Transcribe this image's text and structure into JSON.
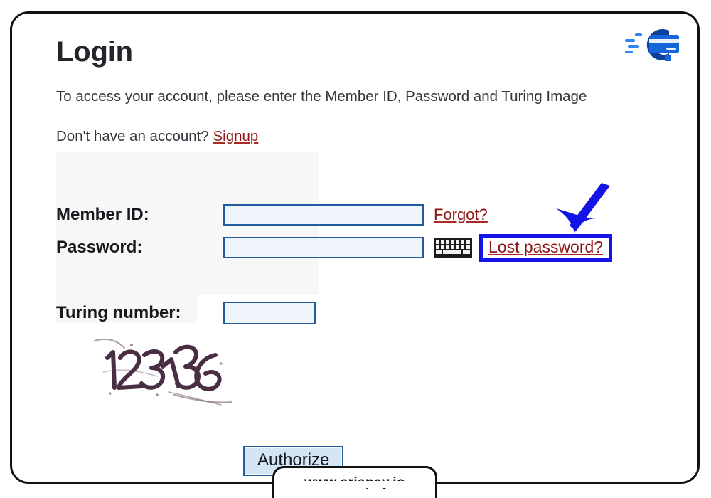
{
  "brand": {
    "logo_icon": "credit-card-motion-logo",
    "colors": {
      "primary": "#1565d8",
      "dark": "#0d3f9e",
      "light": "#2f86f0"
    }
  },
  "page": {
    "title": "Login",
    "intro": "To access your account, please enter the Member ID, Password and Turing Image",
    "signup_prompt": "Don't have an account?",
    "signup_label": "Signup"
  },
  "form": {
    "fields": [
      {
        "label": "Member ID:",
        "value": "",
        "placeholder": "",
        "name": "member-id-input",
        "trailing_link": "Forgot?",
        "has_keyboard_icon": false,
        "highlighted": false
      },
      {
        "label": "Password:",
        "value": "",
        "placeholder": "",
        "name": "password-input",
        "trailing_link": "Lost password?",
        "has_keyboard_icon": true,
        "highlighted": true
      }
    ],
    "turing": {
      "label": "Turing number:",
      "value": "",
      "placeholder": "",
      "captcha_text": "123136",
      "captcha_icon": "captcha-distorted-digits"
    },
    "submit_label": "Authorize"
  },
  "annotation": {
    "arrow_icon": "down-left-arrow-annotation",
    "arrow_color": "#1414e6",
    "highlight_color": "#1414e6",
    "highlight_target": "Lost password?"
  },
  "footer": {
    "url": "www.ariapay.io"
  },
  "icons": {
    "keyboard": "keyboard-icon",
    "logo": "ariapay-logo-icon"
  },
  "theme": {
    "link_color": "#8e1616",
    "input_border": "#215d9c",
    "input_fill": "#eff5fb",
    "button_fill": "#d4e6f5",
    "frame_border": "#111111",
    "panel_bg": "#f7f7f7"
  }
}
